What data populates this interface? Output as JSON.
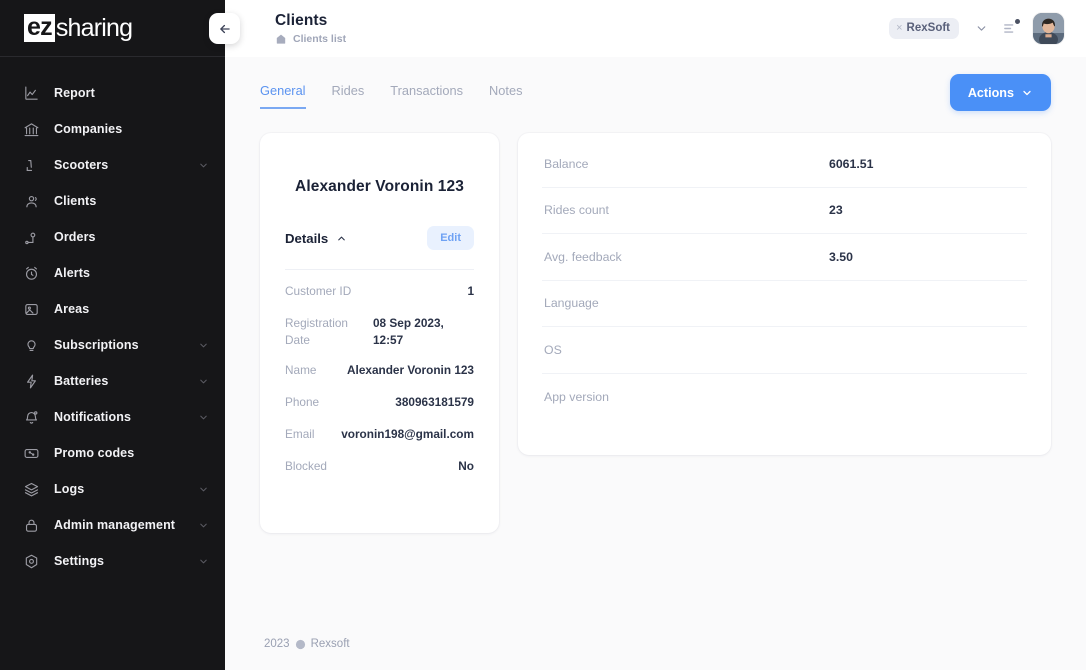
{
  "brand": {
    "part1": "ez",
    "part2": "sharing"
  },
  "sidebar": {
    "collapse_label": "collapse-sidebar",
    "items": [
      {
        "label": "Report",
        "icon": "chart-line-icon",
        "expandable": false
      },
      {
        "label": "Companies",
        "icon": "bank-icon",
        "expandable": false
      },
      {
        "label": "Scooters",
        "icon": "scooter-icon",
        "expandable": true
      },
      {
        "label": "Clients",
        "icon": "users-icon",
        "expandable": false
      },
      {
        "label": "Orders",
        "icon": "map-pin-icon",
        "expandable": false
      },
      {
        "label": "Alerts",
        "icon": "alarm-clock-icon",
        "expandable": false
      },
      {
        "label": "Areas",
        "icon": "image-area-icon",
        "expandable": false
      },
      {
        "label": "Subscriptions",
        "icon": "bulb-icon",
        "expandable": true
      },
      {
        "label": "Batteries",
        "icon": "bolt-icon",
        "expandable": true
      },
      {
        "label": "Notifications",
        "icon": "bell-icon",
        "expandable": true
      },
      {
        "label": "Promo codes",
        "icon": "ticket-percent-icon",
        "expandable": false
      },
      {
        "label": "Logs",
        "icon": "layers-icon",
        "expandable": true
      },
      {
        "label": "Admin management",
        "icon": "lock-icon",
        "expandable": true
      },
      {
        "label": "Settings",
        "icon": "gear-icon",
        "expandable": true
      }
    ]
  },
  "header": {
    "title": "Clients",
    "breadcrumb": "Clients list",
    "breadcrumb_icon": "home-icon",
    "org_chip": {
      "remove": "×",
      "name": "RexSoft"
    },
    "notifications_icon": "notifications-icon",
    "avatar_name": "user-avatar"
  },
  "main": {
    "tabs": [
      {
        "label": "General",
        "active": true
      },
      {
        "label": "Rides",
        "active": false
      },
      {
        "label": "Transactions",
        "active": false
      },
      {
        "label": "Notes",
        "active": false
      }
    ],
    "actions_button": "Actions"
  },
  "details_card": {
    "client_name": "Alexander Voronin 123",
    "section_title": "Details",
    "edit_label": "Edit",
    "rows": [
      {
        "label": "Customer ID",
        "value": "1"
      },
      {
        "label": "Registration Date",
        "value": "08 Sep 2023, 12:57"
      },
      {
        "label": "Name",
        "value": "Alexander Voronin 123"
      },
      {
        "label": "Phone",
        "value": "380963181579"
      },
      {
        "label": "Email",
        "value": "voronin198@gmail.com"
      },
      {
        "label": "Blocked",
        "value": "No"
      }
    ]
  },
  "stats_card": {
    "rows": [
      {
        "label": "Balance",
        "value": "6061.51"
      },
      {
        "label": "Rides count",
        "value": "23"
      },
      {
        "label": "Avg. feedback",
        "value": "3.50"
      },
      {
        "label": "Language",
        "value": ""
      },
      {
        "label": "OS",
        "value": ""
      },
      {
        "label": "App version",
        "value": ""
      }
    ]
  },
  "footer": {
    "year": "2023",
    "company": "Rexsoft"
  },
  "colors": {
    "sidebar_bg": "#161618",
    "accent_blue": "#4a90f7",
    "tab_active": "#5b93f0",
    "page_bg": "#fafafb",
    "card_bg": "#ffffff",
    "label_gray": "#a3a9ba",
    "value_dark": "#2b3348"
  }
}
